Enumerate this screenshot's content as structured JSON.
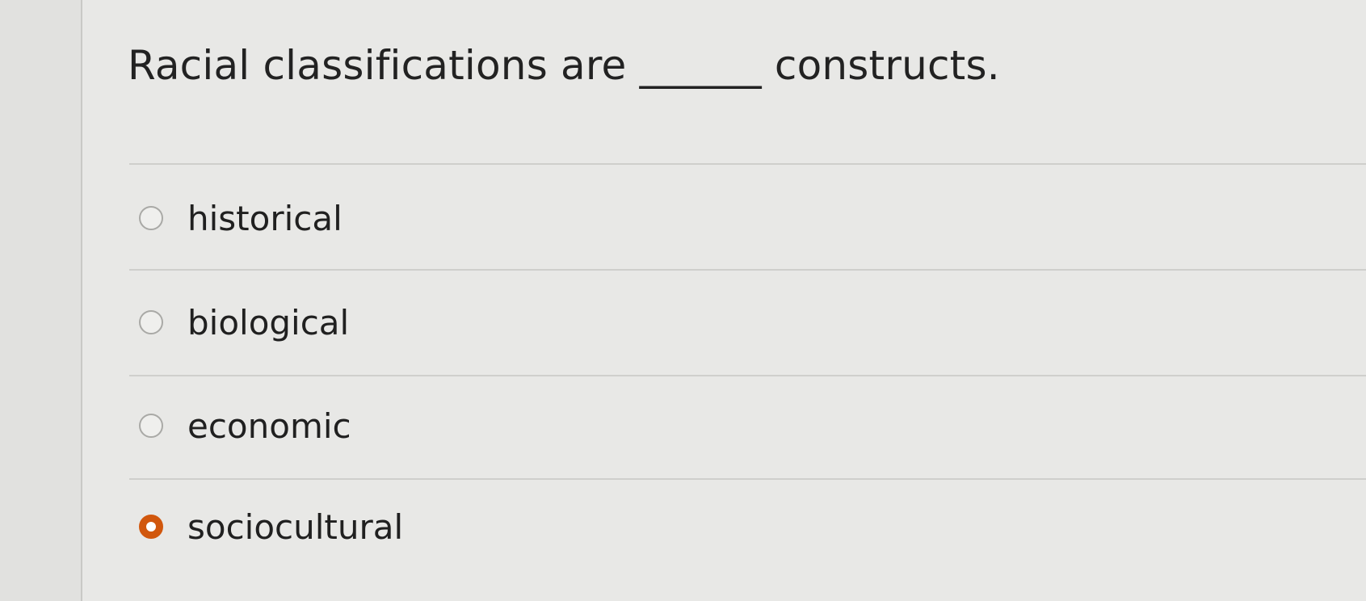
{
  "question": {
    "text": "Racial classifications are ______ constructs."
  },
  "options": [
    {
      "label": "historical",
      "selected": false
    },
    {
      "label": "biological",
      "selected": false
    },
    {
      "label": "economic",
      "selected": false
    },
    {
      "label": "sociocultural",
      "selected": true
    }
  ],
  "colors": {
    "selected_radio": "#d1570d",
    "divider": "#cfcfcc",
    "background": "#e8e8e6"
  },
  "icons": {
    "unselected": "radio-unselected-icon",
    "selected": "radio-selected-icon"
  }
}
